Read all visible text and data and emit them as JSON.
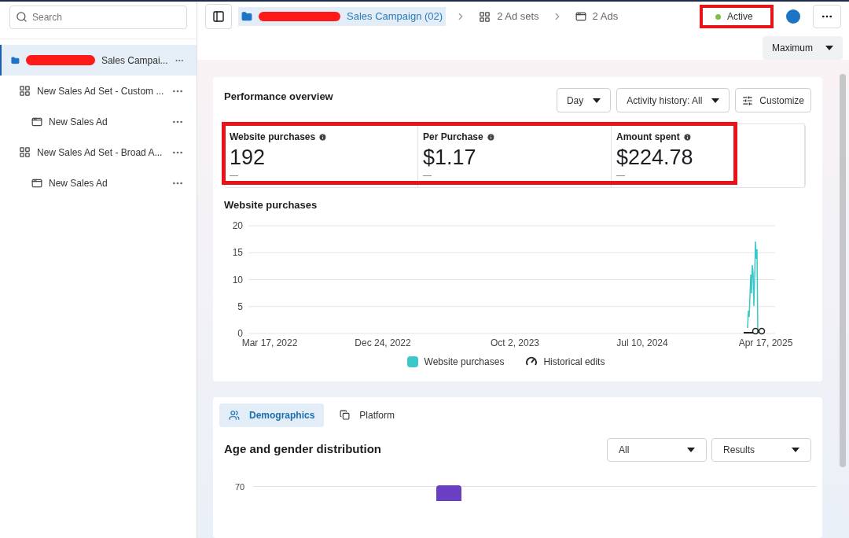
{
  "sidebar": {
    "search": {
      "placeholder": "Search"
    },
    "tree": [
      {
        "kind": "campaign",
        "label": "Sales Campai...",
        "redacted": true,
        "selected": true,
        "children": [
          {
            "kind": "ad_set",
            "label": "New Sales Ad Set - Custom ...",
            "selected": false,
            "children": [
              {
                "kind": "ad",
                "label": "New Sales Ad",
                "selected": false
              }
            ]
          },
          {
            "kind": "ad_set",
            "label": "New Sales Ad Set - Broad A...",
            "selected": false,
            "children": [
              {
                "kind": "ad",
                "label": "New Sales Ad",
                "selected": false
              }
            ]
          }
        ]
      }
    ]
  },
  "breadcrumb": [
    {
      "kind": "campaign",
      "label": "Sales Campaign (02)",
      "redacted": true,
      "selected": true
    },
    {
      "kind": "ad_set",
      "label": "2 Ad sets",
      "selected": false
    },
    {
      "kind": "ad",
      "label": "2 Ads",
      "selected": false
    }
  ],
  "status": {
    "label": "Active",
    "color": "#7cc242",
    "highlighted": true
  },
  "view_select": {
    "value": "Maximum"
  },
  "performance": {
    "title": "Performance overview",
    "controls": [
      {
        "kind": "select",
        "label": "Day"
      },
      {
        "kind": "select",
        "label": "Activity history: All"
      },
      {
        "kind": "customize",
        "label": "Customize"
      }
    ],
    "metrics": {
      "highlighted": true,
      "items": [
        {
          "label": "Website purchases",
          "value": "192",
          "delta": "—"
        },
        {
          "label": "Per Purchase",
          "value": "$1.17",
          "delta": "—"
        },
        {
          "label": "Amount spent",
          "value": "$224.78",
          "delta": "—"
        }
      ]
    },
    "chart": {
      "title": "Website purchases",
      "y_ticks": [
        "20",
        "15",
        "10",
        "5",
        "0"
      ],
      "x_labels": [
        "Mar 17, 2022",
        "Dec 24, 2022",
        "Oct 2, 2023",
        "Jul 10, 2024",
        "Apr 17, 2025"
      ],
      "legend": [
        {
          "kind": "series",
          "label": "Website purchases",
          "color": "#3cc8c8"
        },
        {
          "kind": "edits",
          "label": "Historical edits"
        }
      ]
    }
  },
  "breakdown": {
    "tabs": [
      {
        "kind": "people",
        "label": "Demographics",
        "selected": true
      },
      {
        "kind": "platform",
        "label": "Platform",
        "selected": false
      }
    ],
    "title": "Age and gender distribution",
    "selects": [
      {
        "value": "All"
      },
      {
        "value": "Results"
      }
    ],
    "y_tick": "70"
  }
}
